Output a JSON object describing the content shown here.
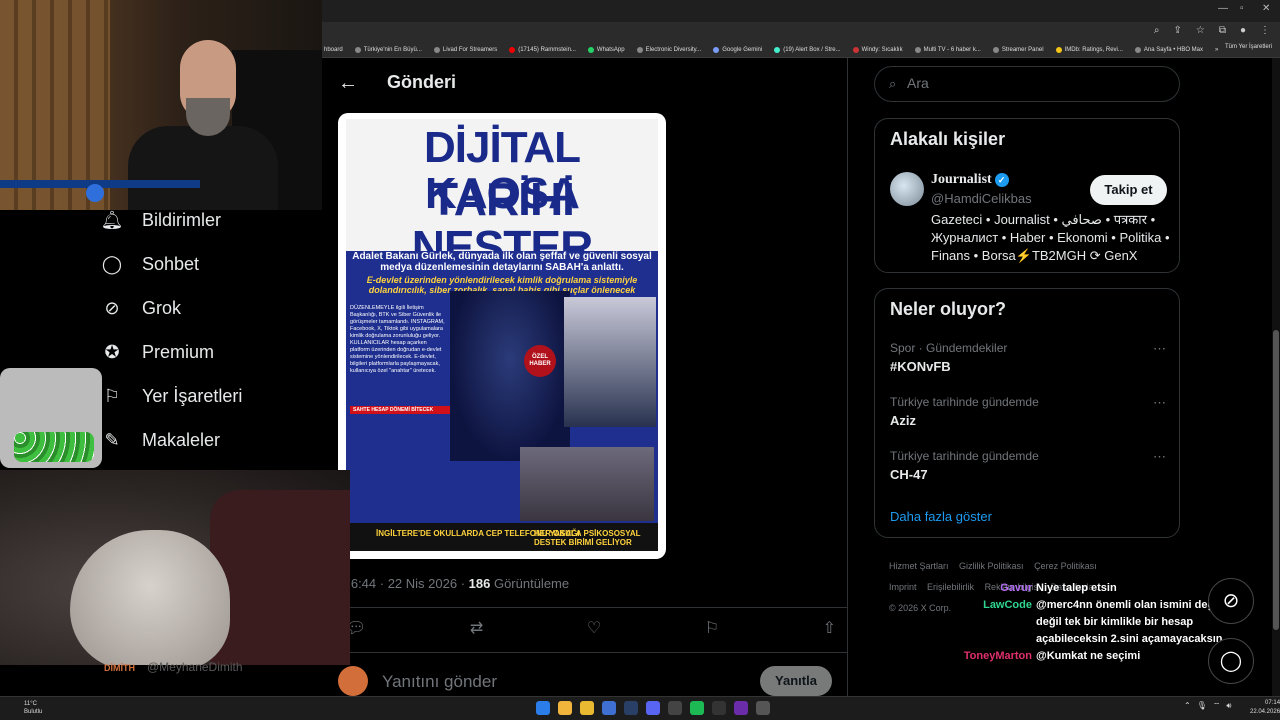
{
  "browser": {
    "bookmarks": [
      "hboard",
      "Türkiye'nin En Büyü...",
      "Livad For Streamers",
      "(17145) Rammstein...",
      "WhatsApp",
      "Electronic Diversity...",
      "Google Gemini",
      "(19) Alert Box / Stre...",
      "Windy: Sıcaklık",
      "Multi TV - 6 haber k...",
      "Streamer Panel",
      "IMDb: Ratings, Revi...",
      "Ana Sayfa • HBO Max"
    ],
    "bookmarks_more": "»",
    "all_bookmarks": "Tüm Yer İşaretleri"
  },
  "header": {
    "back_icon": "arrow-left-icon",
    "title": "Gönderi"
  },
  "newspaper": {
    "headline1": "DİJİTAL KAOSA",
    "headline2": "TARİHİ NEŞTER",
    "subhead": "Adalet Bakanı Gürlek, dünyada ilk olan şeffaf ve güvenli sosyal medya düzenlemesinin detaylarını SABAH'a anlattı.",
    "subhead2": "E-devlet üzerinden yönlendirilecek kimlik doğrulama sistemiyle dolandırıcılık, siber zorbalık, sanal bahis gibi suçlar önlenecek",
    "body": "DÜZENLEMEYLE ilgili İletişim Başkanlığı, BTK ve Siber Güvenlik ile görüşmeler tamamlandı. INSTAGRAM, Facebook, X, Tiktok gibi uygulamalara kimlik doğrulama zorunluluğu geliyor. KULLANICILAR hesap açarken platform üzerinden doğrudan e-devlet sistemine yönlendirilecek. E-devlet, bilgileri platformlarla paylaşmayacak, kullanıcıya özel \"anahtar\" üretecek.",
    "red_label": "SAHTE HESAP DÖNEMİ BİTECEK",
    "badge": "ÖZEL HABER",
    "footer_left": "İNGİLTERE'DE OKULLARDA CEP TELEFONU YASAĞI",
    "footer_right": "HER OKULA PSİKOSOSYAL DESTEK BİRİMİ GELİYOR"
  },
  "post": {
    "time": "ö 6:44 · 22 Nis 2026 · ",
    "views_count": "186",
    "views_label": " Görüntüleme",
    "reply_placeholder": "Yanıtını gönder",
    "reply_button": "Yanıtla"
  },
  "search": {
    "placeholder": "Ara"
  },
  "related": {
    "title": "Alakalı kişiler",
    "name": "Journalist",
    "handle": "@HamdiCelikbas",
    "follow": "Takip et",
    "bio": "Gazeteci • Journalist • صحافي • पत्रकार • Журналист • Haber • Ekonomi • Politika • Finans • Borsa⚡TB2MGH ⟳ GenX"
  },
  "trends": {
    "title": "Neler oluyor?",
    "items": [
      {
        "context": "Spor · Gündemdekiler",
        "name": "#KONvFB"
      },
      {
        "context": "Türkiye tarihinde gündemde",
        "name": "Aziz"
      },
      {
        "context": "Türkiye tarihinde gündemde",
        "name": "CH-47"
      }
    ],
    "more_icon": "⋯",
    "show_more": "Daha fazla göster"
  },
  "footer_links": [
    "Hizmet Şartları",
    "Gizlilik Politikası",
    "Çerez Politikası",
    "Imprint",
    "Erişilebilirlik",
    "Reklam bilgisi",
    "Daha fazla ...",
    "© 2026 X Corp."
  ],
  "nav": [
    {
      "label": "Bildirimler",
      "icon": "bell-icon"
    },
    {
      "label": "Sohbet",
      "icon": "chat-icon"
    },
    {
      "label": "Grok",
      "icon": "grok-icon"
    },
    {
      "label": "Premium",
      "icon": "premium-icon"
    },
    {
      "label": "Yer İşaretleri",
      "icon": "bookmark-icon"
    },
    {
      "label": "Makaleler",
      "icon": "article-icon"
    }
  ],
  "under_cam": {
    "tag": "DİMİTH",
    "handle": "@MeyhaneDimith"
  },
  "chat": [
    {
      "user": "Gavur",
      "color": "#b06cf0",
      "msg": "Niye talep etsin"
    },
    {
      "user": "LawCode",
      "color": "#2fd48f",
      "msg": "@merc4nn önemli olan ismini değişmek değil tek bir kimlikle bir hesap açabileceksin 2.sini açamayacaksın"
    },
    {
      "user": "ToneyMarton",
      "color": "#e0306a",
      "msg": "@Kumkat ne seçimi"
    }
  ],
  "taskbar": {
    "temp": "11°C",
    "weather": "Bulutlu",
    "time": "07:14",
    "date": "22.04.2026"
  }
}
